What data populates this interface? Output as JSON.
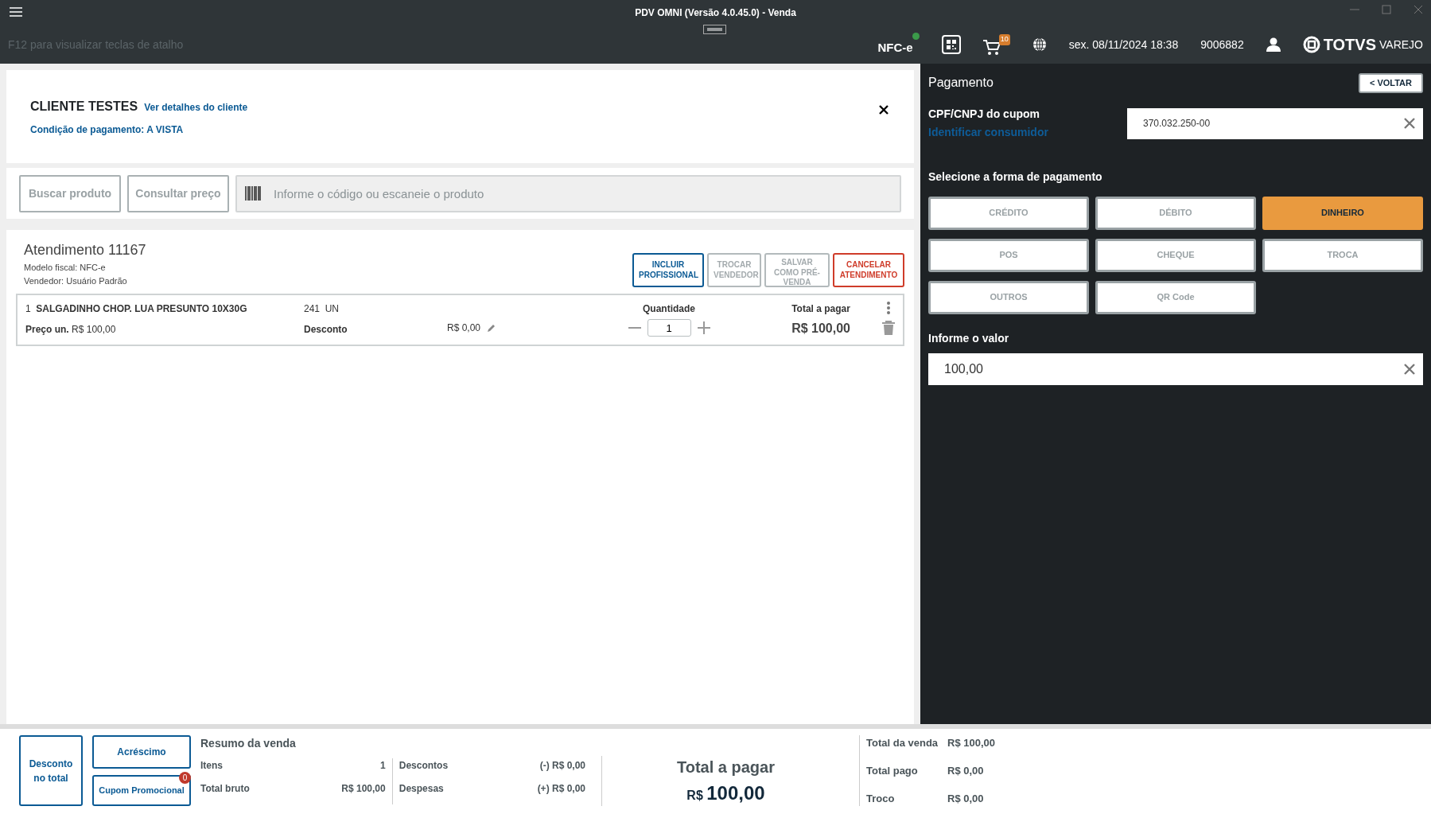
{
  "window": {
    "title": "PDV OMNI (Versão 4.0.45.0) - Venda"
  },
  "header": {
    "hint": "F12 para visualizar teclas de atalho",
    "fiscal": "NFC-e",
    "cart_count": "10",
    "datetime": "sex. 08/11/2024 18:38",
    "terminal": "9006882",
    "brand": "TOTVS",
    "brand_sub": "VAREJO"
  },
  "customer": {
    "name": "CLIENTE TESTES",
    "details_link": "Ver detalhes do cliente",
    "payment_condition": "Condição de pagamento: A VISTA"
  },
  "product_search": {
    "buttons": [
      "Buscar produto",
      "Consultar preço"
    ],
    "placeholder": "Informe o código ou escaneie o produto"
  },
  "sale": {
    "title": "Atendimento 11167",
    "fiscal_model": "Modelo fiscal: NFC-e",
    "seller": "Vendedor: Usuário Padrão",
    "actions": [
      {
        "label": "INCLUIR PROFISSIONAL",
        "kind": "primary"
      },
      {
        "label": "TROCAR VENDEDOR",
        "kind": "muted"
      },
      {
        "label": "SALVAR COMO PRÉ-VENDA",
        "kind": "muted"
      },
      {
        "label": "CANCELAR ATENDIMENTO",
        "kind": "danger"
      }
    ],
    "items": [
      {
        "number": "1",
        "name": "SALGADINHO CHOP. LUA PRESUNTO 10X30G",
        "stock": "241",
        "unit": "UN",
        "price_label": "Preço un.",
        "price": "R$ 100,00",
        "discount_label": "Desconto",
        "discount": "R$ 0,00",
        "quantity_label": "Quantidade",
        "quantity": "1",
        "total_label": "Total a pagar",
        "total": "R$ 100,00"
      }
    ]
  },
  "payment": {
    "title": "Pagamento",
    "back": "<  VOLTAR",
    "cpf_label": "CPF/CNPJ do cupom",
    "identify_link": "Identificar consumidor",
    "cpf": "370.032.250-00",
    "methods_label": "Selecione a forma de pagamento",
    "methods": [
      {
        "label": "CRÉDITO",
        "selected": false
      },
      {
        "label": "DÉBITO",
        "selected": false
      },
      {
        "label": "DINHEIRO",
        "selected": true
      },
      {
        "label": "POS",
        "selected": false
      },
      {
        "label": "CHEQUE",
        "selected": false
      },
      {
        "label": "TROCA",
        "selected": false
      },
      {
        "label": "OUTROS",
        "selected": false
      },
      {
        "label": "QR Code",
        "selected": false
      }
    ],
    "amount_label": "Informe o valor",
    "amount": "100,00"
  },
  "footer": {
    "discount_button": "Desconto no total",
    "surcharge_button": "Acréscimo",
    "coupon_button": "Cupom Promocional",
    "coupon_count": "0",
    "summary_title": "Resumo da venda",
    "summary_left": [
      {
        "label": "Itens",
        "value": "1"
      },
      {
        "label": "Total bruto",
        "value": "R$ 100,00"
      }
    ],
    "summary_right": [
      {
        "label": "Descontos",
        "value": "(-) R$ 0,00"
      },
      {
        "label": "Despesas",
        "value": "(+) R$ 0,00"
      }
    ],
    "total_label": "Total a pagar",
    "total_currency": "R$",
    "total_amount": "100,00",
    "totals": [
      {
        "label": "Total da venda",
        "value": "R$ 100,00"
      },
      {
        "label": "Total pago",
        "value": "R$ 0,00"
      },
      {
        "label": "Troco",
        "value": "R$ 0,00"
      }
    ]
  }
}
